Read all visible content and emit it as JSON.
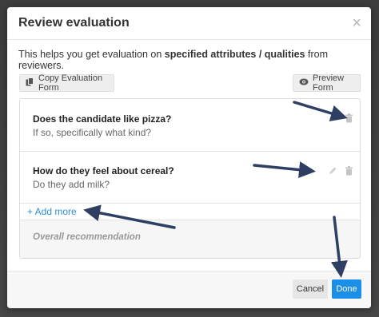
{
  "modal": {
    "title": "Review evaluation",
    "close_glyph": "×",
    "intro_prefix": "This helps you get evaluation on ",
    "intro_bold": "specified attributes / qualities",
    "intro_suffix": " from reviewers."
  },
  "toolbar": {
    "copy_label": "Copy Evaluation Form",
    "copy_icon": "copy-icon",
    "preview_label": "Preview Form",
    "preview_icon": "eye-icon"
  },
  "questions": [
    {
      "title": "Does the candidate like pizza?",
      "subtitle": "If so, specifically what kind?"
    },
    {
      "title": "How do they feel about cereal?",
      "subtitle": "Do they add milk?"
    }
  ],
  "add_more_label": "+ Add more",
  "overall_label": "Overall recommendation",
  "footer": {
    "cancel_label": "Cancel",
    "done_label": "Done"
  },
  "colors": {
    "accent": "#1b8fe8",
    "link": "#2d8fd5",
    "annotation_arrow": "#2f3f63"
  }
}
